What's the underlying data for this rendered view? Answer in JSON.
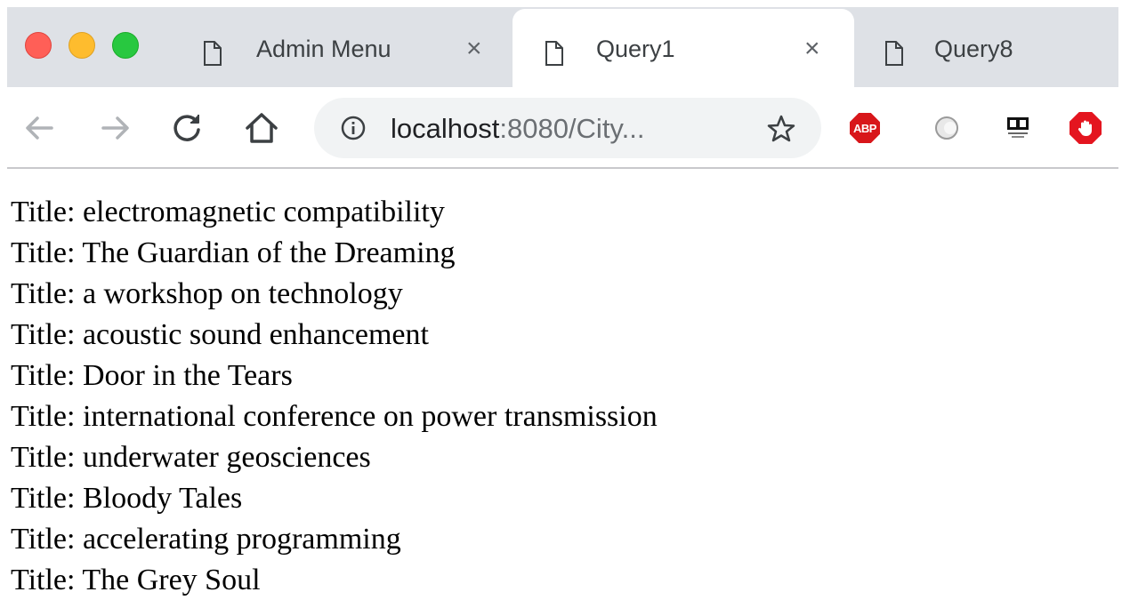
{
  "tabs": [
    {
      "label": "Admin Menu",
      "icon": "document-icon",
      "active": false
    },
    {
      "label": "Query1",
      "icon": "document-icon",
      "active": true
    },
    {
      "label": "Query8",
      "icon": "document-icon",
      "active": false
    }
  ],
  "tab_close_glyph": "×",
  "toolbar": {
    "url_host": "localhost",
    "url_rest": ":8080/City...",
    "extensions": [
      "adblock-plus-icon",
      "circle-extension-icon",
      "dolby-voice-icon",
      "stop-hand-icon"
    ],
    "abp_label": "ABP"
  },
  "colors": {
    "tabbar_bg": "#dee1e6",
    "abp_red": "#d8161a",
    "stop_red": "#e4151f"
  },
  "results": [
    {
      "prefix": "Title:",
      "value": "electromagnetic compatibility"
    },
    {
      "prefix": "Title:",
      "value": "The Guardian of the Dreaming"
    },
    {
      "prefix": "Title:",
      "value": "a workshop on technology"
    },
    {
      "prefix": "Title:",
      "value": "acoustic sound enhancement"
    },
    {
      "prefix": "Title:",
      "value": "Door in the Tears"
    },
    {
      "prefix": "Title:",
      "value": "international conference on power transmission"
    },
    {
      "prefix": "Title:",
      "value": "underwater geosciences"
    },
    {
      "prefix": "Title:",
      "value": "Bloody Tales"
    },
    {
      "prefix": "Title:",
      "value": "accelerating programming"
    },
    {
      "prefix": "Title:",
      "value": "The Grey Soul"
    }
  ]
}
